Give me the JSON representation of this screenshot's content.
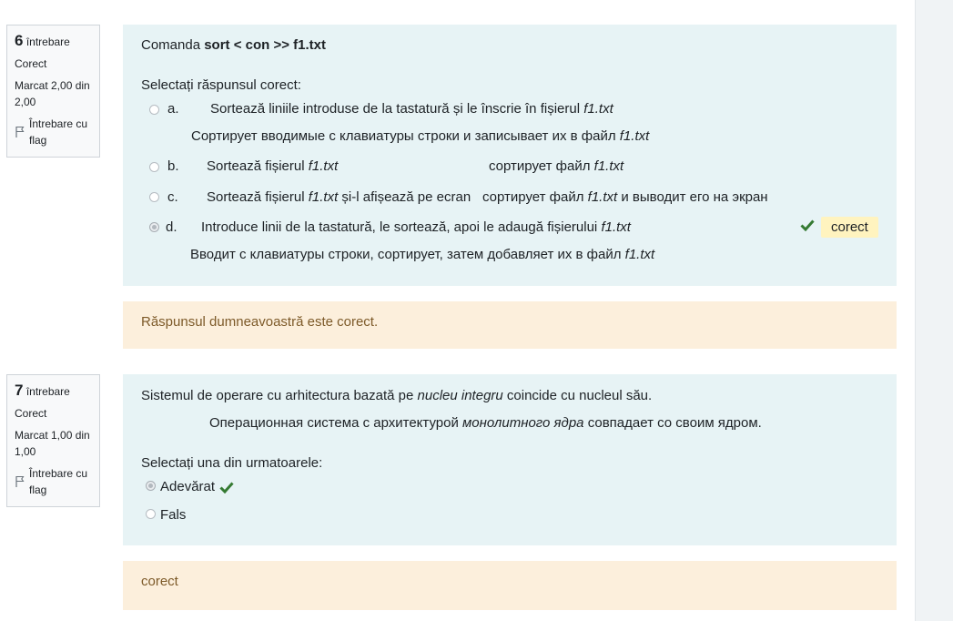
{
  "q6": {
    "info": {
      "number": "6",
      "question_word": "întrebare",
      "status": "Corect",
      "mark": "Marcat 2,00 din 2,00",
      "flag_label": "Întrebare cu flag"
    },
    "stem": {
      "prefix": "Comanda ",
      "command": "sort  < con >> f1.txt"
    },
    "prompt": "Selectați răspunsul corect:",
    "options": [
      {
        "letter": "a.",
        "text_ro": "Sortează liniile introduse de la tastatură și le înscrie în fișierul",
        "file_ro": "f1.txt",
        "text_ru": "Сортирует вводимые с клавиатуры строки и записывает их в файл",
        "file_ru": "f1.txt",
        "selected": false
      },
      {
        "letter": "b.",
        "text_ro": "Sortează fișierul",
        "file_ro": "f1.txt",
        "text_ru": "сортирует файл",
        "file_ru": "f1.txt",
        "selected": false
      },
      {
        "letter": "c.",
        "text_ro": "Sortează fișierul",
        "file_ro": "f1.txt",
        "text_ro_after": "și-l afișează pe ecran",
        "text_ru": "сортирует файл",
        "file_ru": "f1.txt",
        "text_ru_after": "и выводит его на экран",
        "selected": false
      },
      {
        "letter": "d.",
        "text_ro": "Introduce linii de la tastatură, le sortează, apoi le adaugă fișierului",
        "file_ro": "f1.txt",
        "text_ru": "Вводит с клавиатуры строки, сортирует, затем добавляет их в файл",
        "file_ru": "f1.txt",
        "selected": true,
        "result": "corect"
      }
    ],
    "feedback": "Răspunsul dumneavoastră este corect."
  },
  "q7": {
    "info": {
      "number": "7",
      "question_word": "întrebare",
      "status": "Corect",
      "mark": "Marcat 1,00 din 1,00",
      "flag_label": "Întrebare cu flag"
    },
    "stem_ro_prefix": "Sistemul de operare cu arhitectura bazată pe ",
    "stem_ro_em": "nucleu integru",
    "stem_ro_suffix": " coincide cu nucleul său.",
    "stem_ru_prefix": "Операционная система с архитектурой ",
    "stem_ru_em": "монолитного ядра",
    "stem_ru_suffix": " совпадает со своим ядром.",
    "prompt": "Selectați una din urmatoarele:",
    "options": [
      {
        "label": "Adevărat",
        "selected": true
      },
      {
        "label": "Fals",
        "selected": false
      }
    ],
    "feedback": "corect"
  },
  "colors": {
    "question_bg": "#e7f3f5",
    "feedback_bg": "#fcefdc",
    "feedback_text": "#7d5a29",
    "correct_green": "#357a32",
    "badge_bg": "#fff3bf"
  }
}
